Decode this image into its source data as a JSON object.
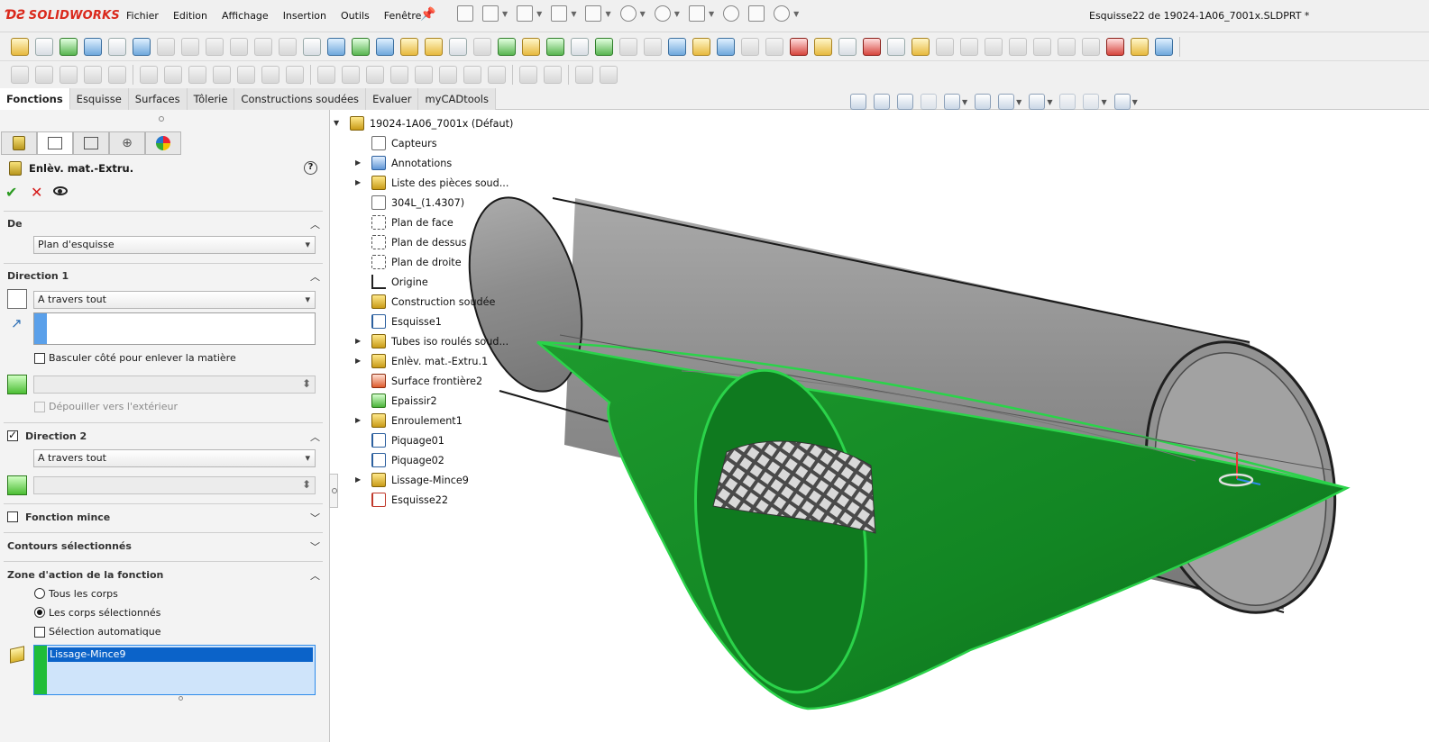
{
  "app": {
    "logo": "SOLIDWORKS",
    "menu": [
      "Fichier",
      "Edition",
      "Affichage",
      "Insertion",
      "Outils",
      "Fenêtre"
    ],
    "window_title": "Esquisse22 de 19024-1A06_7001x.SLDPRT *"
  },
  "command_tabs": [
    "Fonctions",
    "Esquisse",
    "Surfaces",
    "Tôlerie",
    "Constructions soudées",
    "Evaluer",
    "myCADtools"
  ],
  "active_command_tab": "Fonctions",
  "property_manager": {
    "title": "Enlèv. mat.-Extru.",
    "help": "?",
    "ok": "✔",
    "cancel": "✕",
    "de": {
      "title": "De",
      "value": "Plan d'esquisse"
    },
    "direction1": {
      "title": "Direction 1",
      "end_condition": "A travers tout",
      "flip_side": "Basculer côté pour enlever la matière",
      "draft_outward": "Dépouiller vers l'extérieur"
    },
    "direction2": {
      "title": "Direction 2",
      "checked": true,
      "end_condition": "A travers tout"
    },
    "thin_feature": {
      "title": "Fonction mince",
      "checked": false
    },
    "selected_contours": {
      "title": "Contours sélectionnés"
    },
    "feature_scope": {
      "title": "Zone d'action de la fonction",
      "all_bodies": "Tous les corps",
      "selected_bodies": "Les corps sélectionnés",
      "selected_option": "selected_bodies",
      "auto_select": "Sélection automatique",
      "auto_select_checked": false,
      "bodies": [
        "Lissage-Mince9"
      ]
    }
  },
  "tree": {
    "root": "19024-1A06_7001x (Défaut)",
    "items": [
      {
        "label": "Capteurs",
        "icon": "sensor-icon",
        "expandable": false
      },
      {
        "label": "Annotations",
        "icon": "annotation-icon",
        "expandable": true
      },
      {
        "label": "Liste des pièces soud...",
        "icon": "cut-list-icon",
        "expandable": true
      },
      {
        "label": "304L_(1.4307)",
        "icon": "material-icon",
        "expandable": false
      },
      {
        "label": "Plan de face",
        "icon": "plane-icon",
        "expandable": false
      },
      {
        "label": "Plan de dessus",
        "icon": "plane-icon",
        "expandable": false
      },
      {
        "label": "Plan de droite",
        "icon": "plane-icon",
        "expandable": false
      },
      {
        "label": "Origine",
        "icon": "origin-icon",
        "expandable": false
      },
      {
        "label": "Construction soudée",
        "icon": "weldment-icon",
        "expandable": false
      },
      {
        "label": "Esquisse1",
        "icon": "sketch-icon",
        "expandable": false
      },
      {
        "label": "Tubes iso roulés soud...",
        "icon": "structural-member-icon",
        "expandable": true
      },
      {
        "label": "Enlèv. mat.-Extru.1",
        "icon": "extruded-cut-icon",
        "expandable": true
      },
      {
        "label": "Surface frontière2",
        "icon": "boundary-surface-icon",
        "expandable": false
      },
      {
        "label": "Epaissir2",
        "icon": "thicken-icon",
        "expandable": false
      },
      {
        "label": "Enroulement1",
        "icon": "wrap-icon",
        "expandable": true
      },
      {
        "label": "Piquage01",
        "icon": "sketch-3d-icon",
        "expandable": false
      },
      {
        "label": "Piquage02",
        "icon": "sketch-3d-icon",
        "expandable": false
      },
      {
        "label": "Lissage-Mince9",
        "icon": "loft-icon",
        "expandable": true
      },
      {
        "label": "Esquisse22",
        "icon": "sketch-edit-icon",
        "expandable": false
      }
    ]
  },
  "colors": {
    "accent_blue": "#2e8bea",
    "selection_green": "#1fbd39",
    "tube_grey": "#8d8d8d",
    "ok_green": "#2c9b22",
    "cancel_red": "#d51b1b"
  }
}
